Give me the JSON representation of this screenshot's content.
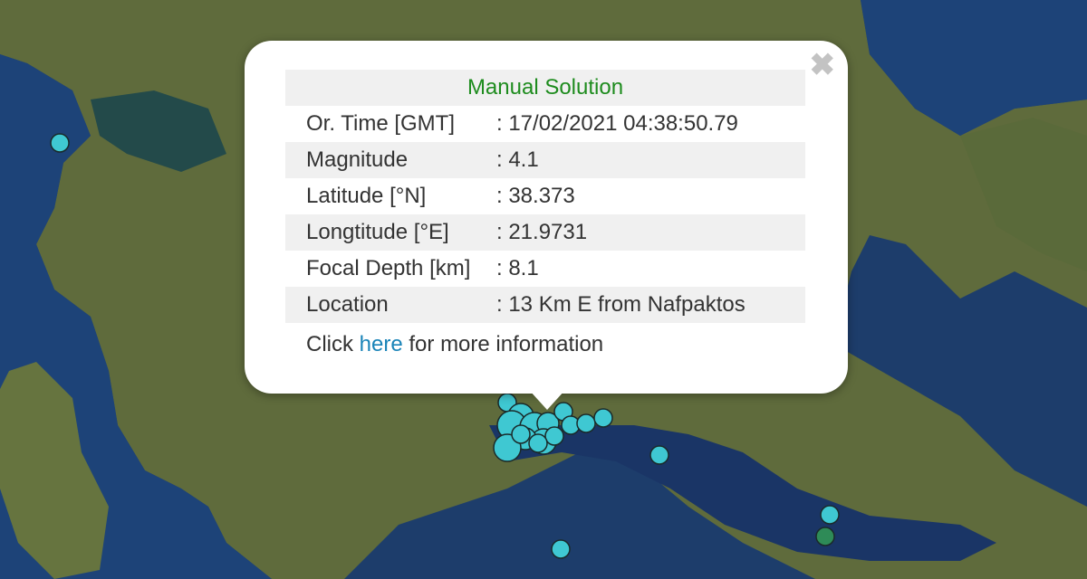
{
  "popup": {
    "title": "Manual Solution",
    "close_glyph": "✖",
    "rows": [
      {
        "label": "Or. Time [GMT]",
        "value": ": 17/02/2021 04:38:50.79"
      },
      {
        "label": "Magnitude",
        "value": ": 4.1"
      },
      {
        "label": "Latitude [°N]",
        "value": ": 38.373"
      },
      {
        "label": "Longtitude [°E]",
        "value": ": 21.9731"
      },
      {
        "label": "Focal Depth [km]",
        "value": ": 8.1"
      },
      {
        "label": "Location",
        "value": ": 13 Km E from Nafpaktos"
      }
    ],
    "more_prefix": "Click ",
    "more_link": "here",
    "more_suffix": " for more information"
  },
  "map": {
    "basemap": "satellite imagery",
    "marker_color": "#3fc8d2",
    "marker_color_alt": "#2e8b57",
    "marker_outline": "#1a2a2a"
  }
}
